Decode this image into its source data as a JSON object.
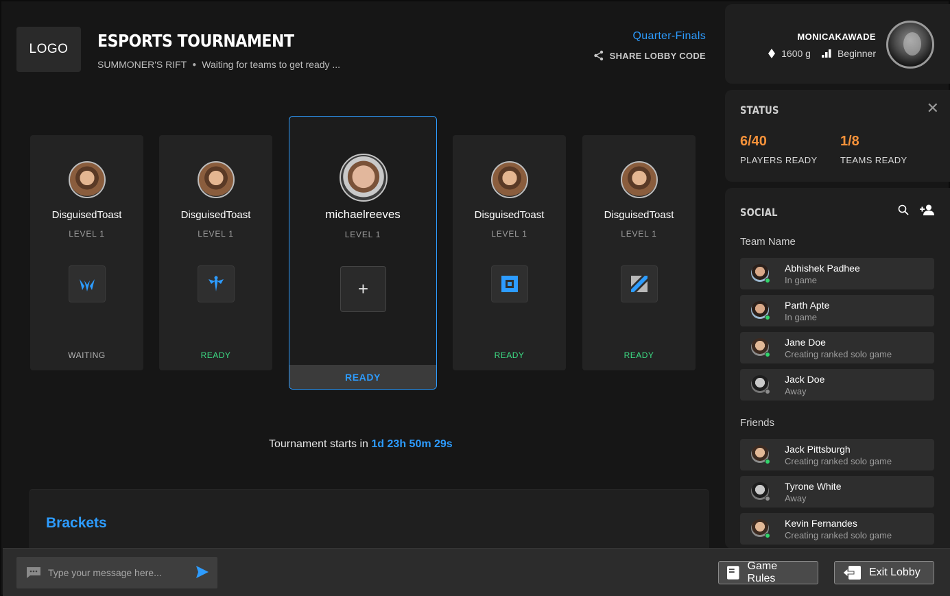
{
  "header": {
    "logo": "LOGO",
    "title": "ESPORTS TOURNAMENT",
    "map": "SUMMONER'S RIFT",
    "state": "Waiting for teams to get ready ...",
    "phase": "Quarter-Finals",
    "share_label": "SHARE LOBBY CODE"
  },
  "profile": {
    "username": "MONICAKAWADE",
    "gold": "1600 g",
    "rank": "Beginner"
  },
  "status": {
    "heading": "STATUS",
    "players_ready": "6/40",
    "players_label": "PLAYERS READY",
    "teams_ready": "1/8",
    "teams_label": "TEAMS READY"
  },
  "social": {
    "heading": "SOCIAL",
    "team_heading": "Team Name",
    "team": [
      {
        "name": "Abhishek Padhee",
        "status": "In game",
        "online": true
      },
      {
        "name": "Parth Apte",
        "status": "In game",
        "online": true
      },
      {
        "name": "Jane Doe",
        "status": "Creating ranked solo game",
        "online": true
      },
      {
        "name": "Jack Doe",
        "status": "Away",
        "online": false
      }
    ],
    "friends_heading": "Friends",
    "friends": [
      {
        "name": "Jack Pittsburgh",
        "status": "Creating ranked solo game",
        "online": true
      },
      {
        "name": "Tyrone White",
        "status": "Away",
        "online": false
      },
      {
        "name": "Kevin Fernandes",
        "status": "Creating ranked solo game",
        "online": true
      }
    ]
  },
  "players": [
    {
      "name": "DisguisedToast",
      "level": "LEVEL 1",
      "state": "WAITING"
    },
    {
      "name": "DisguisedToast",
      "level": "LEVEL 1",
      "state": "READY"
    },
    {
      "name": "michaelreeves",
      "level": "LEVEL 1",
      "state": "READY"
    },
    {
      "name": "DisguisedToast",
      "level": "LEVEL 1",
      "state": "READY"
    },
    {
      "name": "DisguisedToast",
      "level": "LEVEL 1",
      "state": "READY"
    }
  ],
  "main_card": {
    "add_symbol": "+"
  },
  "countdown": {
    "prefix": "Tournament starts in",
    "timer": "1d 23h 50m 29s"
  },
  "brackets": {
    "heading": "Brackets"
  },
  "bottombar": {
    "chat_placeholder": "Type your message here...",
    "rules_label": "Game Rules",
    "exit_label": "Exit Lobby"
  },
  "colors": {
    "accent": "#2d9cff",
    "ready": "#3ddc84",
    "stat": "#f6923a",
    "online": "#32d46b",
    "away": "#8e8e8e"
  }
}
